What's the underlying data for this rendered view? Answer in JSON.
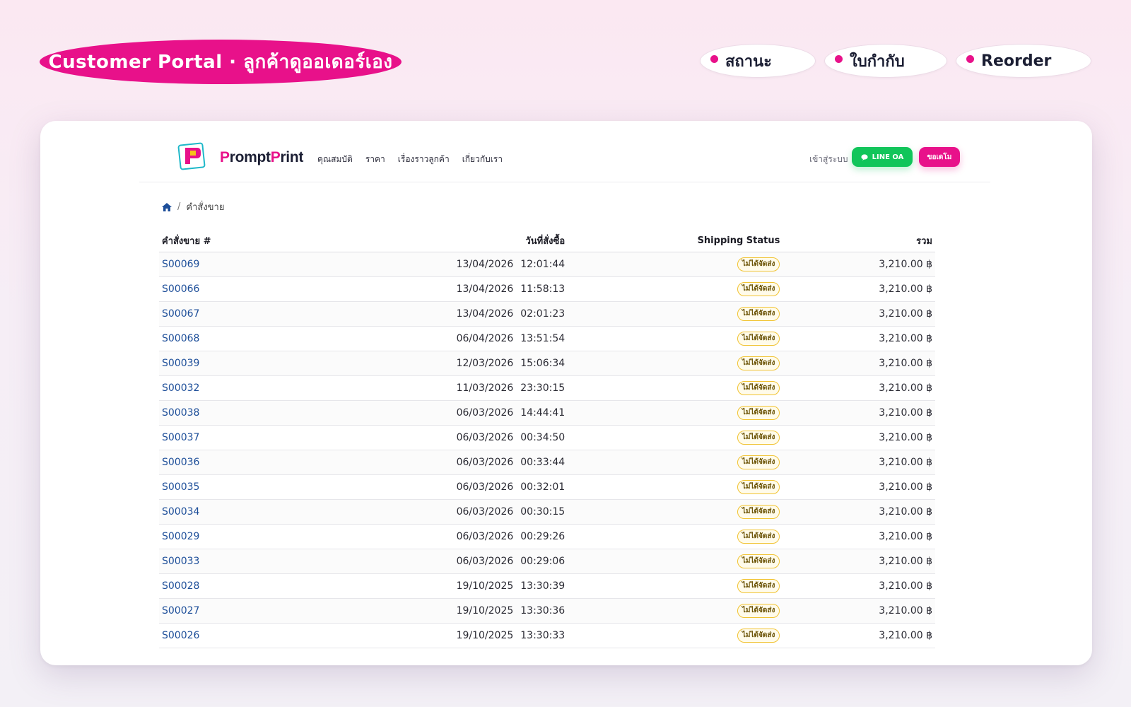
{
  "headline": "Customer Portal · ลูกค้าดูออเดอร์เอง",
  "feature_pills": [
    "สถานะ",
    "ใบกำกับ",
    "Reorder"
  ],
  "colors": {
    "accent": "#e8118a",
    "line_green": "#11c55a",
    "link_blue": "#1d4e99",
    "badge_border": "#f1c332"
  },
  "nav": {
    "brand_p": "P",
    "brand_rompt": "rompt",
    "brand_p2": "P",
    "brand_rint": "rint",
    "menu": [
      "คุณสมบัติ",
      "ราคา",
      "เรื่องราวลูกค้า",
      "เกี่ยวกับเรา"
    ],
    "login": "เข้าสู่ระบบ",
    "line_button": "LINE OA",
    "line_icon": "chat-bubble-icon",
    "quote_button": "ขอเดโม"
  },
  "breadcrumb": {
    "home_icon": "home-icon",
    "separator": "/",
    "current": "คำสั่งขาย"
  },
  "table": {
    "headers": {
      "order": "คำสั่งขาย #",
      "date": "วันที่สั่งซื้อ",
      "shipping": "Shipping Status",
      "total": "รวม"
    },
    "rows": [
      {
        "id": "S00069",
        "date": "13/04/2026",
        "time": "12:01:44",
        "status": "ไม่ได้จัดส่ง",
        "total": "3,210.00 ฿"
      },
      {
        "id": "S00066",
        "date": "13/04/2026",
        "time": "11:58:13",
        "status": "ไม่ได้จัดส่ง",
        "total": "3,210.00 ฿"
      },
      {
        "id": "S00067",
        "date": "13/04/2026",
        "time": "02:01:23",
        "status": "ไม่ได้จัดส่ง",
        "total": "3,210.00 ฿"
      },
      {
        "id": "S00068",
        "date": "06/04/2026",
        "time": "13:51:54",
        "status": "ไม่ได้จัดส่ง",
        "total": "3,210.00 ฿"
      },
      {
        "id": "S00039",
        "date": "12/03/2026",
        "time": "15:06:34",
        "status": "ไม่ได้จัดส่ง",
        "total": "3,210.00 ฿"
      },
      {
        "id": "S00032",
        "date": "11/03/2026",
        "time": "23:30:15",
        "status": "ไม่ได้จัดส่ง",
        "total": "3,210.00 ฿"
      },
      {
        "id": "S00038",
        "date": "06/03/2026",
        "time": "14:44:41",
        "status": "ไม่ได้จัดส่ง",
        "total": "3,210.00 ฿"
      },
      {
        "id": "S00037",
        "date": "06/03/2026",
        "time": "00:34:50",
        "status": "ไม่ได้จัดส่ง",
        "total": "3,210.00 ฿"
      },
      {
        "id": "S00036",
        "date": "06/03/2026",
        "time": "00:33:44",
        "status": "ไม่ได้จัดส่ง",
        "total": "3,210.00 ฿"
      },
      {
        "id": "S00035",
        "date": "06/03/2026",
        "time": "00:32:01",
        "status": "ไม่ได้จัดส่ง",
        "total": "3,210.00 ฿"
      },
      {
        "id": "S00034",
        "date": "06/03/2026",
        "time": "00:30:15",
        "status": "ไม่ได้จัดส่ง",
        "total": "3,210.00 ฿"
      },
      {
        "id": "S00029",
        "date": "06/03/2026",
        "time": "00:29:26",
        "status": "ไม่ได้จัดส่ง",
        "total": "3,210.00 ฿"
      },
      {
        "id": "S00033",
        "date": "06/03/2026",
        "time": "00:29:06",
        "status": "ไม่ได้จัดส่ง",
        "total": "3,210.00 ฿"
      },
      {
        "id": "S00028",
        "date": "19/10/2025",
        "time": "13:30:39",
        "status": "ไม่ได้จัดส่ง",
        "total": "3,210.00 ฿"
      },
      {
        "id": "S00027",
        "date": "19/10/2025",
        "time": "13:30:36",
        "status": "ไม่ได้จัดส่ง",
        "total": "3,210.00 ฿"
      },
      {
        "id": "S00026",
        "date": "19/10/2025",
        "time": "13:30:33",
        "status": "ไม่ได้จัดส่ง",
        "total": "3,210.00 ฿"
      }
    ]
  }
}
